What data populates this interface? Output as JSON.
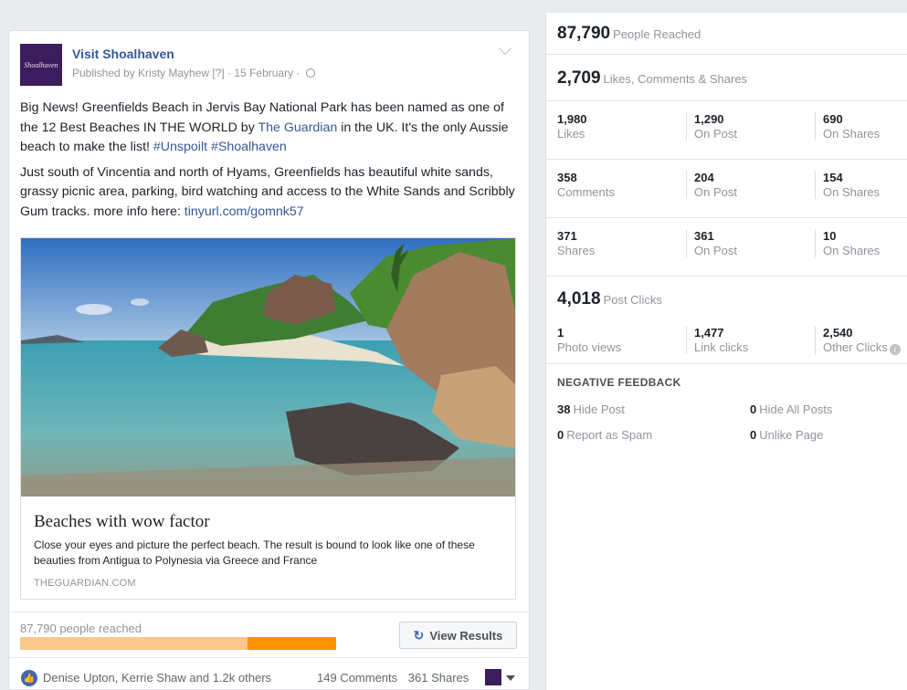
{
  "post": {
    "page_name": "Visit Shoalhaven",
    "avatar_text": "Shoalhaven",
    "meta": "Published by Kristy Mayhew [?] · 15 February ·",
    "para1_before": "Big News! Greenfields Beach in Jervis Bay National Park has been named as one of the 12 Best Beaches IN THE WORLD by ",
    "para1_link": "The Guardian",
    "para1_after": " in the UK. It's the only Aussie beach to make the list! ",
    "para1_hashtags": "#Unspoilt #Shoalhaven",
    "para2_before": "Just south of Vincentia and north of Hyams, Greenfields has beautiful white sands, grassy picnic area, parking, bird watching and access to the White Sands and Scribbly Gum tracks. more info here: ",
    "para2_link": "tinyurl.com/gomnk57",
    "preview": {
      "title": "Beaches with wow factor",
      "description": "Close your eyes and picture the perfect beach. The result is bound to look like one of these beauties from Antigua to Polynesia via Greece and France",
      "domain": "THEGUARDIAN.COM"
    },
    "reach_text": "87,790 people reached",
    "reach_organic_fraction": 0.72,
    "reach_paid_fraction": 0.28,
    "view_results_label": "View Results",
    "likers": "Denise Upton, Kerrie Shaw and 1.2k others",
    "comments": "149 Comments",
    "shares": "361 Shares"
  },
  "insights": {
    "people_reached": {
      "value": "87,790",
      "label": "People Reached"
    },
    "engagement": {
      "value": "2,709",
      "label": "Likes, Comments & Shares"
    },
    "likes_row": [
      {
        "value": "1,980",
        "label": "Likes"
      },
      {
        "value": "1,290",
        "label": "On Post"
      },
      {
        "value": "690",
        "label": "On Shares"
      }
    ],
    "comments_row": [
      {
        "value": "358",
        "label": "Comments"
      },
      {
        "value": "204",
        "label": "On Post"
      },
      {
        "value": "154",
        "label": "On Shares"
      }
    ],
    "shares_row": [
      {
        "value": "371",
        "label": "Shares"
      },
      {
        "value": "361",
        "label": "On Post"
      },
      {
        "value": "10",
        "label": "On Shares"
      }
    ],
    "post_clicks": {
      "value": "4,018",
      "label": "Post Clicks"
    },
    "clicks_row": [
      {
        "value": "1",
        "label": "Photo views"
      },
      {
        "value": "1,477",
        "label": "Link clicks"
      },
      {
        "value": "2,540",
        "label": "Other Clicks"
      }
    ],
    "negative_feedback": {
      "title": "NEGATIVE FEEDBACK",
      "hide_post": {
        "value": "38",
        "label": "Hide Post"
      },
      "hide_all": {
        "value": "0",
        "label": "Hide All Posts"
      },
      "spam": {
        "value": "0",
        "label": "Report as Spam"
      },
      "unlike": {
        "value": "0",
        "label": "Unlike Page"
      }
    }
  },
  "colors": {
    "link": "#365899",
    "muted": "#90949c",
    "reach_paid": "#f99300",
    "reach_organic": "#f9c88a"
  }
}
